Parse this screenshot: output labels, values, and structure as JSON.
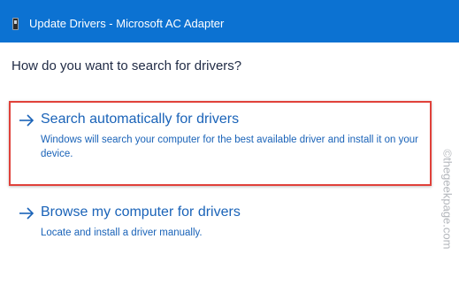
{
  "window": {
    "title": "Update Drivers - Microsoft AC Adapter"
  },
  "prompt": {
    "question": "How do you want to search for drivers?"
  },
  "options": [
    {
      "title": "Search automatically for drivers",
      "description": "Windows will search your computer for the best available driver and install it on your device.",
      "highlighted": true
    },
    {
      "title": "Browse my computer for drivers",
      "description": "Locate and install a driver manually.",
      "highlighted": false
    }
  ],
  "watermark": {
    "text": "©thegeekpage.com"
  },
  "colors": {
    "titlebar": "#0c72d2",
    "link": "#1a63b8",
    "highlight": "#e0413a"
  },
  "icons": {
    "window": "device-icon",
    "option": "arrow-right-icon"
  }
}
